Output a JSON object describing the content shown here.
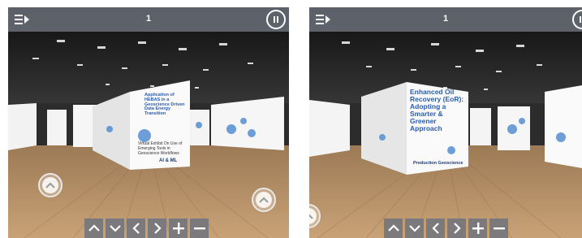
{
  "viewer_left": {
    "page_number": "1",
    "board_front": {
      "title": "Application of HEBAS in a Geoscience Driven Data Energy Transition",
      "subtitle": "Virtual Exhibit On Use of Emerging Tools in Geoscience Workflows",
      "tagline": "AI & ML"
    }
  },
  "viewer_right": {
    "page_number": "1",
    "board_front": {
      "title": "Enhanced Oil Recovery (EoR): Adopting a Smarter & Greener Approach",
      "footer": "Production Geoscience"
    }
  },
  "icons": {
    "menu": "menu-arrow-icon",
    "exit": "exit-pause-icon",
    "up": "chevron-up-icon",
    "down": "chevron-down-icon",
    "left": "chevron-left-icon",
    "right": "chevron-right-icon",
    "zoom_in": "plus-icon",
    "zoom_out": "minus-icon"
  },
  "colors": {
    "toolbar": "#6e737d",
    "board_title": "#2a5db0",
    "floor": "#b48a5c",
    "ceiling": "#1e1e1e"
  }
}
